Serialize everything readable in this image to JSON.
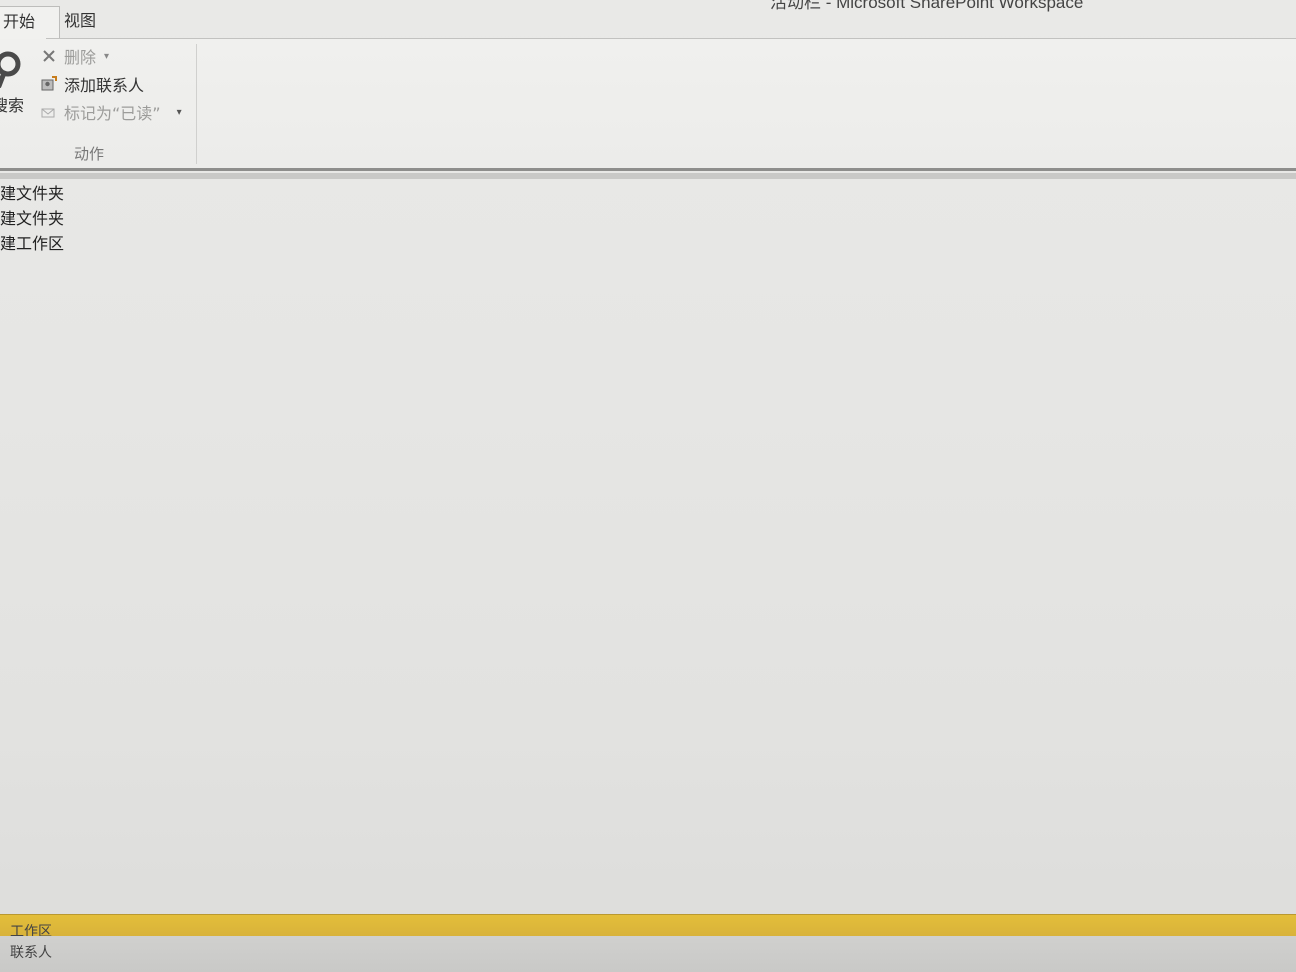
{
  "window": {
    "title_fragment": "活动栏 - Microsoft SharePoint Workspace"
  },
  "tabs": [
    {
      "label": "开始",
      "active": true
    },
    {
      "label": "视图",
      "active": false
    }
  ],
  "ribbon": {
    "search": {
      "label": "搜索",
      "icon": "magnifier-icon"
    },
    "actions": {
      "delete_label": "删除",
      "add_contact_label": "添加联系人",
      "mark_read_label": "标记为“已读”",
      "group_label": "动作"
    }
  },
  "nav_items": [
    {
      "label": "新建文件夹"
    },
    {
      "label": "新建文件夹"
    },
    {
      "label": "新建工作区"
    }
  ],
  "status": {
    "workspaces_label": "工作区",
    "contacts_label": "联系人"
  }
}
